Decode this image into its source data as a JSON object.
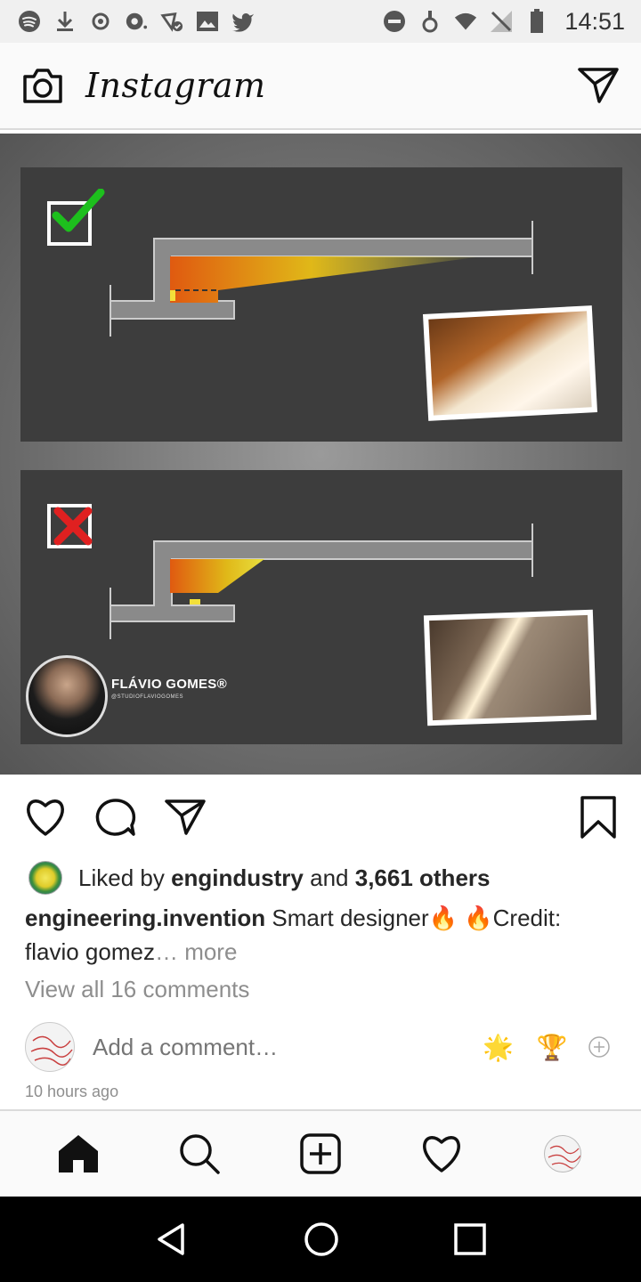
{
  "status_bar": {
    "time": "14:51",
    "left_icons": [
      "spotify-icon",
      "download-icon",
      "sync-icon",
      "camera-icon",
      "share-network-icon",
      "image-icon",
      "twitter-icon"
    ],
    "right_icons": [
      "do-not-disturb-icon",
      "alarm-icon",
      "wifi-icon",
      "no-sim-icon",
      "battery-icon"
    ]
  },
  "header": {
    "title": "Instagram"
  },
  "post": {
    "image": {
      "author_name": "FLÁVIO GOMES®",
      "author_handle": "@STUDIOFLAVIOGOMES"
    },
    "likes": {
      "prefix": "Liked by",
      "user": "engindustry",
      "conjunction": "and",
      "others": "3,661 others"
    },
    "caption": {
      "username": "engineering.invention",
      "text": "Smart designer🔥 🔥Credit: flavio gomez",
      "more": "… more"
    },
    "view_comments": "View all 16 comments",
    "add_comment_placeholder": "Add a comment…",
    "quick_emojis": [
      "🌟",
      "🏆"
    ],
    "timestamp": "10 hours ago"
  },
  "colors": {
    "accent_check": "#1dbf1d",
    "accent_cross": "#e02020",
    "text": "#262626",
    "muted": "#8e8e8e"
  }
}
